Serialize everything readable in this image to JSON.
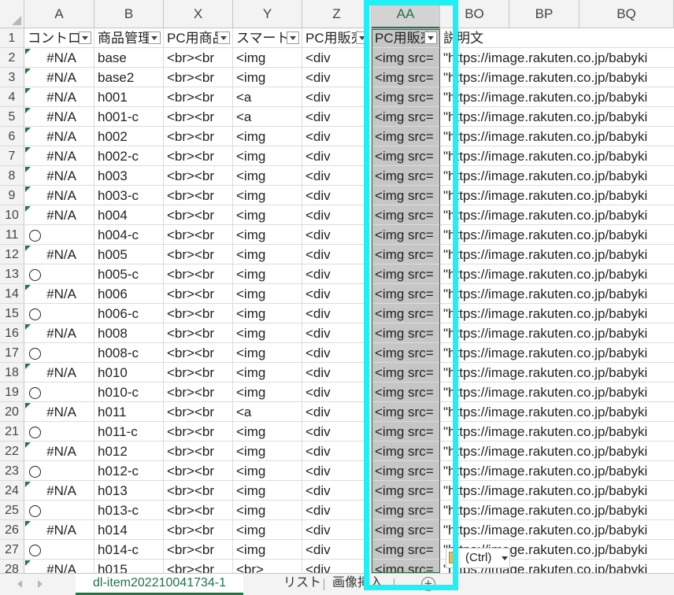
{
  "columns": [
    {
      "letter": "A",
      "selected": false
    },
    {
      "letter": "B",
      "selected": false
    },
    {
      "letter": "X",
      "selected": false
    },
    {
      "letter": "Y",
      "selected": false
    },
    {
      "letter": "Z",
      "selected": false
    },
    {
      "letter": "AA",
      "selected": true
    },
    {
      "letter": "BO",
      "selected": false
    },
    {
      "letter": "BP",
      "selected": false
    },
    {
      "letter": "BQ",
      "selected": false
    }
  ],
  "header_row": {
    "number": "1",
    "A": "コントロ",
    "B": "商品管理",
    "X": "PC用商品",
    "Y": "スマート",
    "Z": "PC用販売",
    "AA": "PC用販売",
    "BO": "説明文"
  },
  "rows": [
    {
      "n": "2",
      "A": "#N/A",
      "B": "base",
      "X": "<br><br",
      "Y": "<img",
      "Z": "<div",
      "AA": "<img src=",
      "BO": "\"https://image.rakuten.co.jp/babyki"
    },
    {
      "n": "3",
      "A": "#N/A",
      "B": "base2",
      "X": "<br><br",
      "Y": "<img",
      "Z": "<div",
      "AA": "<img src=",
      "BO": "\"https://image.rakuten.co.jp/babyki"
    },
    {
      "n": "4",
      "A": "#N/A",
      "B": "h001",
      "X": "<br><br",
      "Y": "<a",
      "Z": "<div",
      "AA": "<img src=",
      "BO": "\"https://image.rakuten.co.jp/babyki"
    },
    {
      "n": "5",
      "A": "#N/A",
      "B": "h001-c",
      "X": "<br><br",
      "Y": "<a",
      "Z": "<div",
      "AA": "<img src=",
      "BO": "\"https://image.rakuten.co.jp/babyki"
    },
    {
      "n": "6",
      "A": "#N/A",
      "B": "h002",
      "X": "<br><br",
      "Y": "<img",
      "Z": "<div",
      "AA": "<img src=",
      "BO": "\"https://image.rakuten.co.jp/babyki"
    },
    {
      "n": "7",
      "A": "#N/A",
      "B": "h002-c",
      "X": "<br><br",
      "Y": "<img",
      "Z": "<div",
      "AA": "<img src=",
      "BO": "\"https://image.rakuten.co.jp/babyki"
    },
    {
      "n": "8",
      "A": "#N/A",
      "B": "h003",
      "X": "<br><br",
      "Y": "<img",
      "Z": "<div",
      "AA": "<img src=",
      "BO": "\"https://image.rakuten.co.jp/babyki"
    },
    {
      "n": "9",
      "A": "#N/A",
      "B": "h003-c",
      "X": "<br><br",
      "Y": "<img",
      "Z": "<div",
      "AA": "<img src=",
      "BO": "\"https://image.rakuten.co.jp/babyki"
    },
    {
      "n": "10",
      "A": "#N/A",
      "B": "h004",
      "X": "<br><br",
      "Y": "<img",
      "Z": "<div",
      "AA": "<img src=",
      "BO": "\"https://image.rakuten.co.jp/babyki"
    },
    {
      "n": "11",
      "A": "○",
      "B": "h004-c",
      "X": "<br><br",
      "Y": "<img",
      "Z": "<div",
      "AA": "<img src=",
      "BO": "\"https://image.rakuten.co.jp/babyki"
    },
    {
      "n": "12",
      "A": "#N/A",
      "B": "h005",
      "X": "<br><br",
      "Y": "<img",
      "Z": "<div",
      "AA": "<img src=",
      "BO": "\"https://image.rakuten.co.jp/babyki"
    },
    {
      "n": "13",
      "A": "○",
      "B": "h005-c",
      "X": "<br><br",
      "Y": "<img",
      "Z": "<div",
      "AA": "<img src=",
      "BO": "\"https://image.rakuten.co.jp/babyki"
    },
    {
      "n": "14",
      "A": "#N/A",
      "B": "h006",
      "X": "<br><br",
      "Y": "<img",
      "Z": "<div",
      "AA": "<img src=",
      "BO": "\"https://image.rakuten.co.jp/babyki"
    },
    {
      "n": "15",
      "A": "○",
      "B": "h006-c",
      "X": "<br><br",
      "Y": "<img",
      "Z": "<div",
      "AA": "<img src=",
      "BO": "\"https://image.rakuten.co.jp/babyki"
    },
    {
      "n": "16",
      "A": "#N/A",
      "B": "h008",
      "X": "<br><br",
      "Y": "<img",
      "Z": "<div",
      "AA": "<img src=",
      "BO": "\"https://image.rakuten.co.jp/babyki"
    },
    {
      "n": "17",
      "A": "○",
      "B": "h008-c",
      "X": "<br><br",
      "Y": "<img",
      "Z": "<div",
      "AA": "<img src=",
      "BO": "\"https://image.rakuten.co.jp/babyki"
    },
    {
      "n": "18",
      "A": "#N/A",
      "B": "h010",
      "X": "<br><br",
      "Y": "<img",
      "Z": "<div",
      "AA": "<img src=",
      "BO": "\"https://image.rakuten.co.jp/babyki"
    },
    {
      "n": "19",
      "A": "○",
      "B": "h010-c",
      "X": "<br><br",
      "Y": "<img",
      "Z": "<div",
      "AA": "<img src=",
      "BO": "\"https://image.rakuten.co.jp/babyki"
    },
    {
      "n": "20",
      "A": "#N/A",
      "B": "h011",
      "X": "<br><br",
      "Y": "<a",
      "Z": "<div",
      "AA": "<img src=",
      "BO": "\"https://image.rakuten.co.jp/babyki"
    },
    {
      "n": "21",
      "A": "○",
      "B": "h011-c",
      "X": "<br><br",
      "Y": "<img",
      "Z": "<div",
      "AA": "<img src=",
      "BO": "\"https://image.rakuten.co.jp/babyki"
    },
    {
      "n": "22",
      "A": "#N/A",
      "B": "h012",
      "X": "<br><br",
      "Y": "<img",
      "Z": "<div",
      "AA": "<img src=",
      "BO": "\"https://image.rakuten.co.jp/babyki"
    },
    {
      "n": "23",
      "A": "○",
      "B": "h012-c",
      "X": "<br><br",
      "Y": "<img",
      "Z": "<div",
      "AA": "<img src=",
      "BO": "\"https://image.rakuten.co.jp/babyki"
    },
    {
      "n": "24",
      "A": "#N/A",
      "B": "h013",
      "X": "<br><br",
      "Y": "<img",
      "Z": "<div",
      "AA": "<img src=",
      "BO": "\"https://image.rakuten.co.jp/babyki"
    },
    {
      "n": "25",
      "A": "○",
      "B": "h013-c",
      "X": "<br><br",
      "Y": "<img",
      "Z": "<div",
      "AA": "<img src=",
      "BO": "\"https://image.rakuten.co.jp/babyki"
    },
    {
      "n": "26",
      "A": "#N/A",
      "B": "h014",
      "X": "<br><br",
      "Y": "<img",
      "Z": "<div",
      "AA": "<img src=",
      "BO": "\"https://image.rakuten.co.jp/babyki"
    },
    {
      "n": "27",
      "A": "○",
      "B": "h014-c",
      "X": "<br><br",
      "Y": "<img",
      "Z": "<div",
      "AA": "<img src=",
      "BO": "\"https://image.rakuten.co.jp/babyki"
    },
    {
      "n": "28",
      "A": "#N/A",
      "B": "h015",
      "X": "<br><br",
      "Y": "<br>",
      "Z": "<div",
      "AA": "<img src=",
      "BO": "\"https://image.rakuten.co.jp/babyki"
    }
  ],
  "paste_options": {
    "label": "(Ctrl)",
    "icon": "clipboard-icon"
  },
  "sheet_tabs": [
    {
      "label": "dl-item202210041734-1",
      "active": true
    },
    {
      "label": "リスト",
      "active": false
    },
    {
      "label": "画像挿入",
      "active": false
    }
  ],
  "icons": {
    "add_sheet": "plus-circle-icon",
    "nav_prev": "triangle-left-icon",
    "nav_next": "triangle-right-icon",
    "filter": "filter-dropdown-icon"
  },
  "colors": {
    "highlight": "#1ff0f5",
    "excel_green": "#217346",
    "selected_column_fill": "#c6c6c6"
  }
}
